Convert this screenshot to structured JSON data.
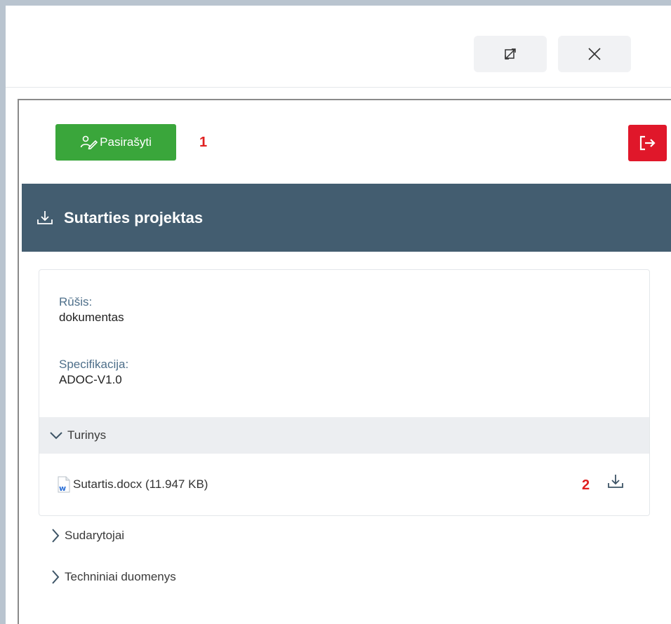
{
  "header": {
    "expand_icon": "expand-arrows-icon",
    "close_icon": "close-x-icon"
  },
  "toolbar": {
    "sign_label": "Pasirašyti",
    "sign_icon": "user-signature-icon",
    "marker1": "1",
    "exit_icon": "exit-arrow-icon"
  },
  "document": {
    "title": "Sutarties projektas",
    "title_icon": "download-icon",
    "fields": [
      {
        "label": "Rūšis:",
        "value": "dokumentas"
      },
      {
        "label": "Specifikacija:",
        "value": "ADOC-V1.0"
      }
    ],
    "content": {
      "label": "Turinys",
      "file": {
        "name": "Sutartis.docx (11.947 KB)",
        "icon": "word-file-icon"
      },
      "marker2": "2"
    },
    "sections": [
      {
        "label": "Sudarytojai"
      },
      {
        "label": "Techniniai duomenys"
      }
    ]
  },
  "colors": {
    "sign_green": "#3aa63b",
    "exit_red": "#e0172a",
    "title_bar": "#435d70",
    "marker_red": "#e02020"
  }
}
